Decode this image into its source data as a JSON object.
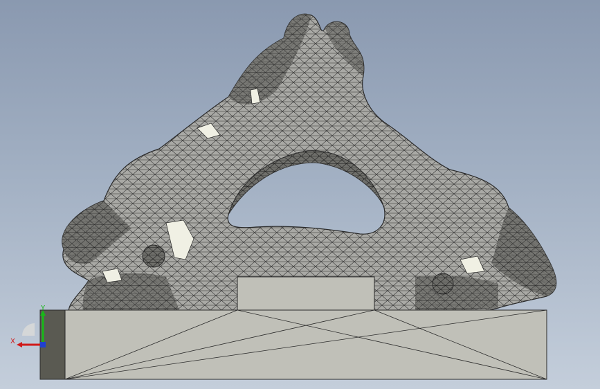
{
  "viewport": {
    "background_top": "#8a99b0",
    "background_bottom": "#c4cedb"
  },
  "model": {
    "mesh_color": "#a9a9a5",
    "mesh_line_color": "#2c2c2c",
    "base_color": "#c0c0b8",
    "base_side_color": "#5a5a52",
    "highlight_color": "#f0f0e4"
  },
  "triad": {
    "x_label": "X",
    "y_label": "Y",
    "x_color": "#d01818",
    "y_color": "#18b818",
    "z_color": "#2040d0"
  }
}
